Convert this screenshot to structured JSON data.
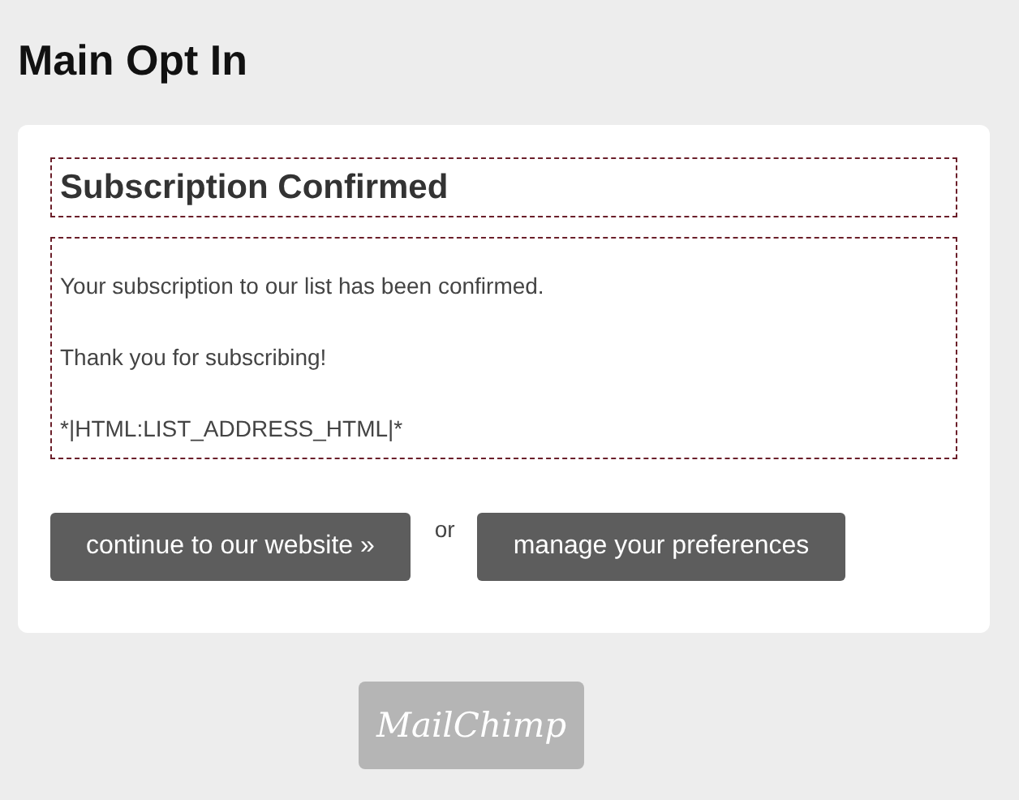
{
  "page_title": "Main Opt In",
  "card": {
    "heading": "Subscription Confirmed",
    "paragraphs": [
      "Your subscription to our list has been confirmed.",
      "Thank you for subscribing!",
      "*|HTML:LIST_ADDRESS_HTML|*"
    ],
    "buttons": [
      {
        "label": "continue to our website »"
      },
      {
        "label": "manage your preferences"
      }
    ],
    "separator": "or"
  },
  "footer_logo": "MailChimp"
}
